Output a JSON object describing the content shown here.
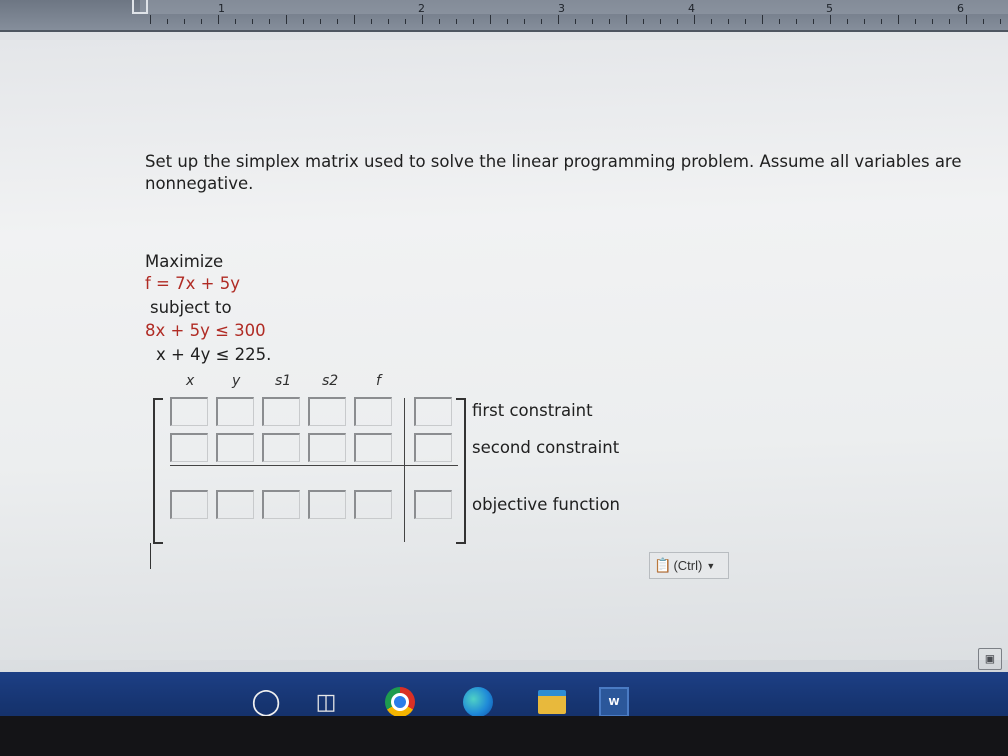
{
  "ruler": {
    "numbers": [
      "1",
      "2",
      "3",
      "4",
      "5",
      "6"
    ]
  },
  "question": {
    "prompt": "Set up the simplex matrix used to solve the linear programming problem. Assume all variables are nonnegative.",
    "maximize_label": "Maximize",
    "objective": "f = 7x + 5y",
    "subject_to": "subject to",
    "constraint1": "8x + 5y ≤ 300",
    "constraint2": "x + 4y ≤ 225."
  },
  "matrix": {
    "column_headers": [
      "x",
      "y",
      "s1",
      "s2",
      "f"
    ],
    "row_labels": [
      "first constraint",
      "second constraint",
      "objective function"
    ],
    "cells": [
      [
        "",
        "",
        "",
        "",
        "",
        ""
      ],
      [
        "",
        "",
        "",
        "",
        "",
        ""
      ],
      [
        "",
        "",
        "",
        "",
        "",
        ""
      ]
    ]
  },
  "paste_options": {
    "label": "(Ctrl)"
  },
  "taskbar": {
    "word_label": "W",
    "icons": [
      "search-icon",
      "task-view-icon",
      "chrome-icon",
      "edge-icon",
      "file-explorer-icon",
      "word-icon"
    ]
  }
}
